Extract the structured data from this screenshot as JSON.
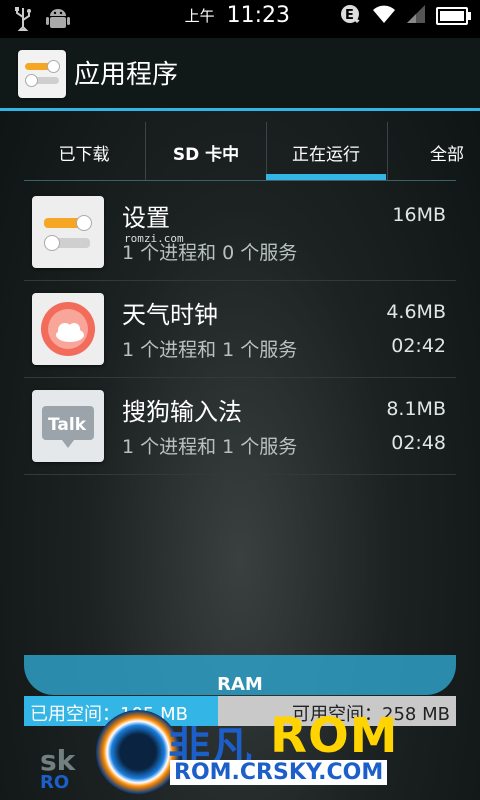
{
  "status_bar": {
    "ampm": "上午",
    "time": "11:23",
    "icons": [
      "usb-icon",
      "android-debug-icon",
      "e-data-icon",
      "wifi-icon",
      "signal-icon",
      "battery-icon"
    ]
  },
  "action_bar": {
    "title": "应用程序",
    "icon": "settings-app-icon"
  },
  "tabs": [
    {
      "label": "已下载",
      "selected": false
    },
    {
      "label": "SD 卡中",
      "selected": false
    },
    {
      "label": "正在运行",
      "selected": true
    },
    {
      "label": "全部",
      "selected": false
    }
  ],
  "processes": [
    {
      "name": "设置",
      "sub": "1 个进程和 0 个服务",
      "size": "16MB",
      "time": "",
      "icon": "settings-icon"
    },
    {
      "name": "天气时钟",
      "sub": "1 个进程和 1 个服务",
      "size": "4.6MB",
      "time": "02:42",
      "icon": "weather-clock-icon"
    },
    {
      "name": "搜狗输入法",
      "sub": "1 个进程和 1 个服务",
      "size": "8.1MB",
      "time": "02:48",
      "icon": "talk-icon"
    }
  ],
  "ram": {
    "title": "RAM",
    "used_label": "已用空间：105 MB",
    "free_label": "可用空间：258 MB",
    "used_fraction": 0.45
  },
  "watermark": {
    "brand_cn": "非凡",
    "brand_rom": "ROM",
    "url": "ROM.CRSKY.COM",
    "side_text": "sk",
    "side_text2": "RO",
    "tiny": "romzi.com"
  },
  "colors": {
    "accent": "#33b5e5",
    "ram_free": "#c9c9c9",
    "brand_yellow": "#ffd400",
    "brand_blue": "#1d5fc8"
  }
}
